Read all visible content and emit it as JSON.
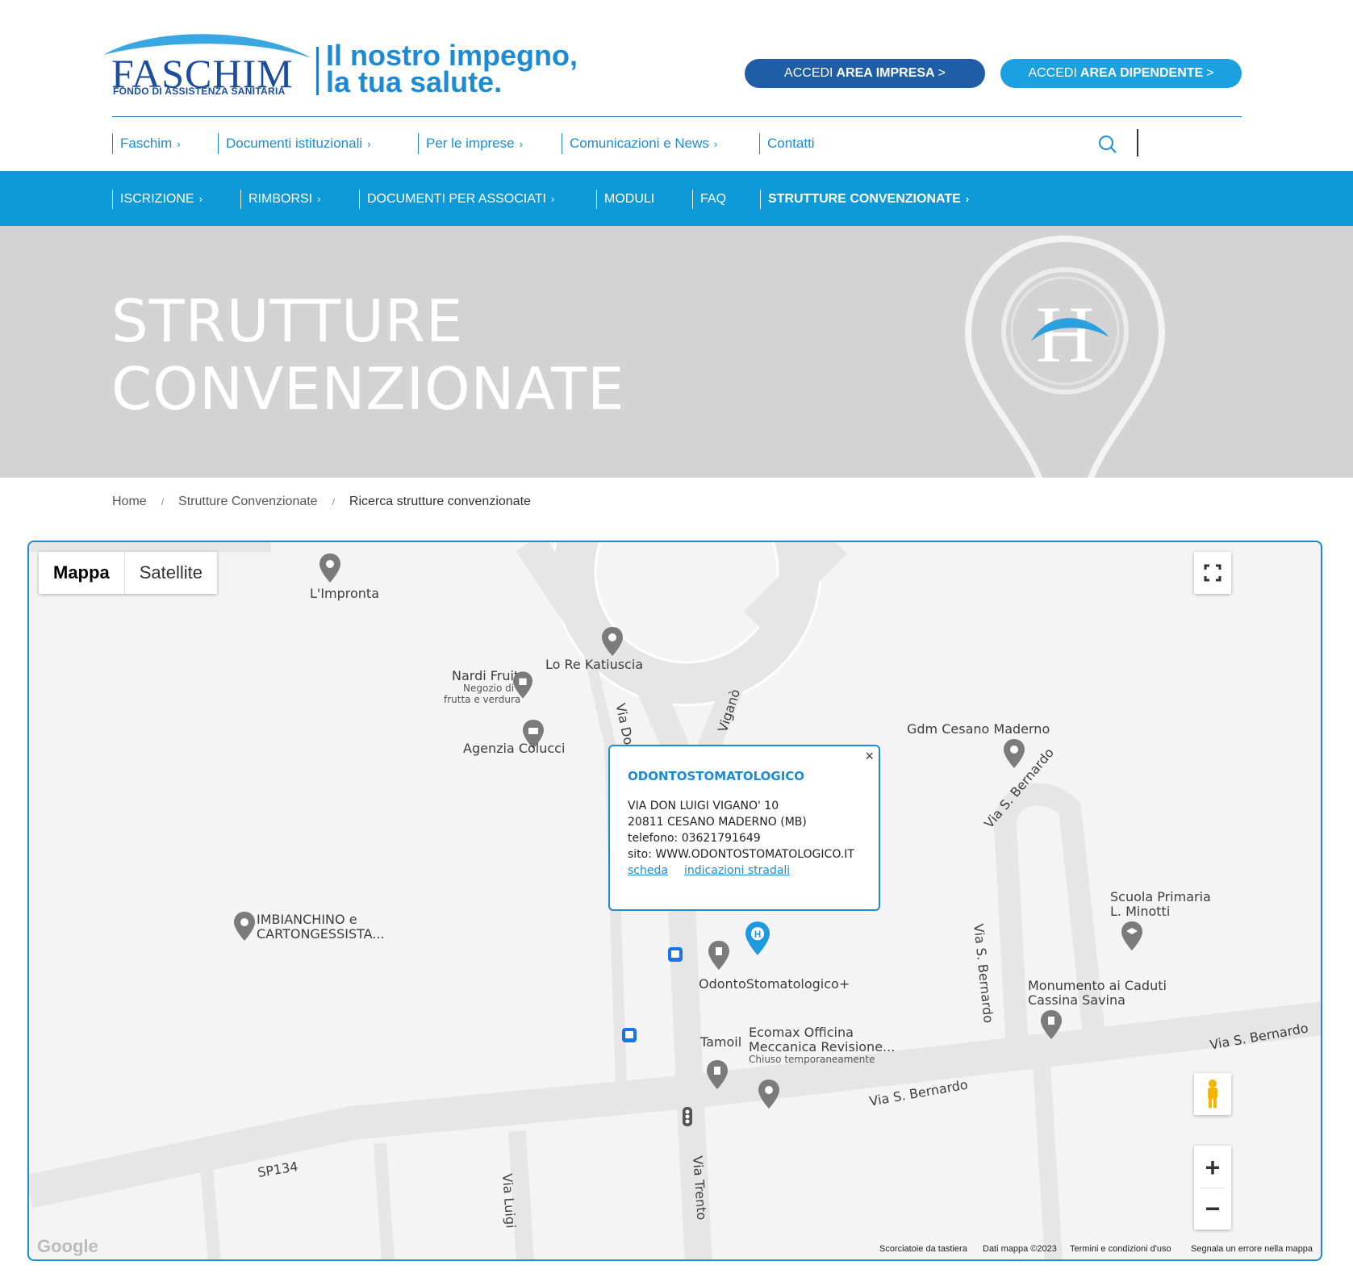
{
  "header": {
    "logo": {
      "wordmark": "FASCHIM",
      "subtitle": "FONDO DI ASSISTENZA SANITARIA"
    },
    "slogan_line1": "Il nostro impegno,",
    "slogan_line2": "la tua salute.",
    "btn_impresa": {
      "prefix": "ACCEDI",
      "bold": "AREA IMPRESA",
      "suffix": ">"
    },
    "btn_dipendente": {
      "prefix": "ACCEDI",
      "bold": "AREA DIPENDENTE",
      "suffix": ">"
    },
    "top_nav": [
      "Faschim",
      "Documenti istituzionali",
      "Per le imprese",
      "Comunicazioni e News",
      "Contatti"
    ]
  },
  "blue_nav": [
    "ISCRIZIONE",
    "RIMBORSI",
    "DOCUMENTI PER ASSOCIATI",
    "MODULI",
    "FAQ",
    "STRUTTURE CONVENZIONATE"
  ],
  "hero": {
    "title_line1": "STRUTTURE",
    "title_line2": "CONVENZIONATE"
  },
  "breadcrumb": [
    "Home",
    "Strutture Convenzionate",
    "Ricerca strutture convenzionate"
  ],
  "map": {
    "type_toggle": [
      "Mappa",
      "Satellite"
    ],
    "places": {
      "limpronta": "L'Impronta",
      "lore": "Lo Re Katiuscia",
      "nardi": "Nardi Fruit",
      "nardi_sub1": "Negozio di",
      "nardi_sub2": "frutta e verdura",
      "agenzia": "Agenzia Colucci",
      "gdm": "Gdm Cesano Maderno",
      "imbianchino1": "IMBIANCHINO e",
      "imbianchino2": "CARTONGESSISTA...",
      "odonto": "OdontoStomatologico+",
      "scuola1": "Scuola Primaria",
      "scuola2": "L. Minotti",
      "monumento1": "Monumento ai Caduti",
      "monumento2": "Cassina Savina",
      "tamoil": "Tamoil",
      "ecomax1": "Ecomax Officina",
      "ecomax2": "Meccanica Revisione...",
      "ecomax3": "Chiuso temporaneamente"
    },
    "streets": {
      "via_don": "Via Don",
      "vigano": "Viganò",
      "via_sbernardo": "Via S. Bernardo",
      "sp134": "SP134",
      "via_luigi": "Via Luigi",
      "via_trento": "Via Trento"
    },
    "info_window": {
      "title": "ODONTOSTOMATOLOGICO",
      "address": "VIA DON LUIGI VIGANO' 10",
      "city": "20811 CESANO MADERNO (MB)",
      "phone": "telefono: 03621791649",
      "site": "sito: WWW.ODONTOSTOMATOLOGICO.IT",
      "link_scheda": "scheda",
      "link_indicazioni": "indicazioni stradali",
      "close": "×"
    },
    "footer": [
      "Scorciatoie da tastiera",
      "Dati mappa ©2023",
      "Termini e condizioni d'uso",
      "Segnala un errore nella mappa"
    ],
    "google": "Google",
    "zoom_in": "+",
    "zoom_out": "−"
  },
  "colors": {
    "primary_blue": "#0e9ad8",
    "dark_blue": "#1f5da6",
    "hero_gray": "#d3d3d3"
  }
}
